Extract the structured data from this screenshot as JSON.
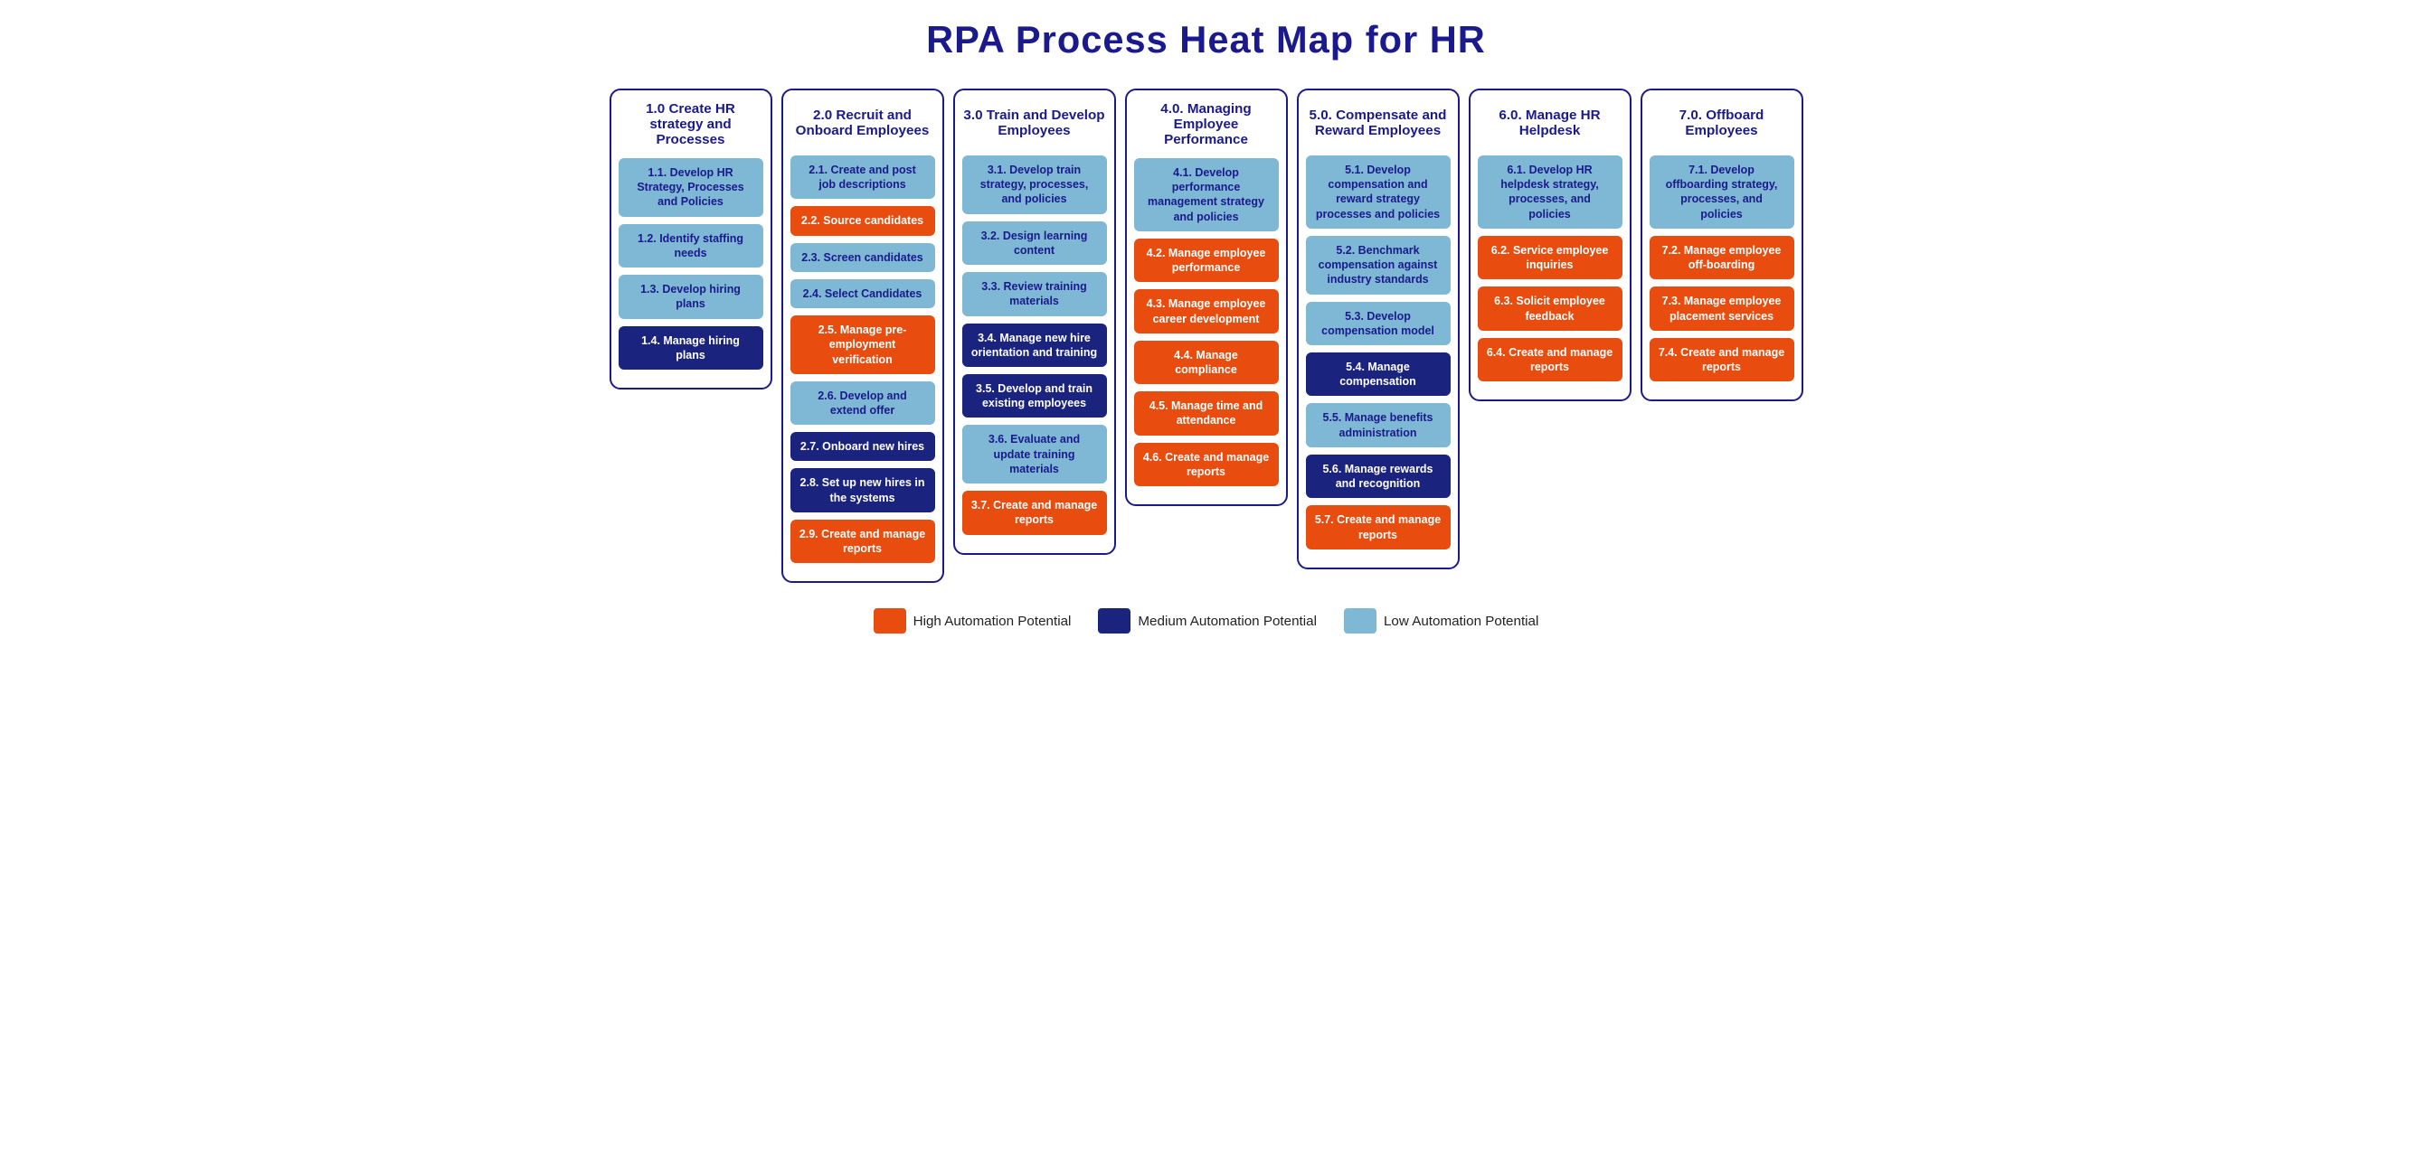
{
  "title": "RPA Process Heat Map for HR",
  "columns": [
    {
      "id": "col1",
      "header": "1.0 Create HR strategy and Processes",
      "cards": [
        {
          "label": "1.1. Develop HR Strategy, Processes and Policies",
          "level": "low"
        },
        {
          "label": "1.2. Identify staffing needs",
          "level": "low"
        },
        {
          "label": "1.3. Develop hiring plans",
          "level": "low"
        },
        {
          "label": "1.4. Manage hiring plans",
          "level": "medium"
        }
      ]
    },
    {
      "id": "col2",
      "header": "2.0 Recruit and Onboard Employees",
      "cards": [
        {
          "label": "2.1. Create and post job descriptions",
          "level": "low"
        },
        {
          "label": "2.2. Source candidates",
          "level": "high"
        },
        {
          "label": "2.3. Screen candidates",
          "level": "low"
        },
        {
          "label": "2.4. Select Candidates",
          "level": "low"
        },
        {
          "label": "2.5. Manage pre-employment verification",
          "level": "high"
        },
        {
          "label": "2.6. Develop and extend offer",
          "level": "low"
        },
        {
          "label": "2.7. Onboard new hires",
          "level": "medium"
        },
        {
          "label": "2.8. Set up new hires in the systems",
          "level": "medium"
        },
        {
          "label": "2.9. Create and manage reports",
          "level": "high"
        }
      ]
    },
    {
      "id": "col3",
      "header": "3.0 Train and Develop Employees",
      "cards": [
        {
          "label": "3.1. Develop train strategy, processes, and policies",
          "level": "low"
        },
        {
          "label": "3.2. Design learning content",
          "level": "low"
        },
        {
          "label": "3.3. Review training materials",
          "level": "low"
        },
        {
          "label": "3.4. Manage new hire orientation and training",
          "level": "medium"
        },
        {
          "label": "3.5. Develop and train existing employees",
          "level": "medium"
        },
        {
          "label": "3.6. Evaluate and update training materials",
          "level": "low"
        },
        {
          "label": "3.7. Create and manage reports",
          "level": "high"
        }
      ]
    },
    {
      "id": "col4",
      "header": "4.0. Managing Employee Performance",
      "cards": [
        {
          "label": "4.1. Develop performance management strategy and policies",
          "level": "low"
        },
        {
          "label": "4.2. Manage employee performance",
          "level": "high"
        },
        {
          "label": "4.3. Manage employee career development",
          "level": "high"
        },
        {
          "label": "4.4. Manage compliance",
          "level": "high"
        },
        {
          "label": "4.5. Manage time and attendance",
          "level": "high"
        },
        {
          "label": "4.6. Create and manage reports",
          "level": "high"
        }
      ]
    },
    {
      "id": "col5",
      "header": "5.0. Compensate and Reward Employees",
      "cards": [
        {
          "label": "5.1. Develop compensation and reward strategy processes and policies",
          "level": "low"
        },
        {
          "label": "5.2. Benchmark compensation against industry standards",
          "level": "low"
        },
        {
          "label": "5.3. Develop compensation model",
          "level": "low"
        },
        {
          "label": "5.4. Manage compensation",
          "level": "medium"
        },
        {
          "label": "5.5. Manage benefits administration",
          "level": "low"
        },
        {
          "label": "5.6. Manage rewards and recognition",
          "level": "medium"
        },
        {
          "label": "5.7. Create and manage reports",
          "level": "high"
        }
      ]
    },
    {
      "id": "col6",
      "header": "6.0. Manage HR Helpdesk",
      "cards": [
        {
          "label": "6.1. Develop HR helpdesk strategy, processes, and policies",
          "level": "low"
        },
        {
          "label": "6.2. Service employee inquiries",
          "level": "high"
        },
        {
          "label": "6.3. Solicit employee feedback",
          "level": "high"
        },
        {
          "label": "6.4. Create and manage reports",
          "level": "high"
        }
      ]
    },
    {
      "id": "col7",
      "header": "7.0. Offboard Employees",
      "cards": [
        {
          "label": "7.1. Develop offboarding strategy, processes, and policies",
          "level": "low"
        },
        {
          "label": "7.2. Manage employee off-boarding",
          "level": "high"
        },
        {
          "label": "7.3. Manage employee placement services",
          "level": "high"
        },
        {
          "label": "7.4. Create and manage reports",
          "level": "high"
        }
      ]
    }
  ],
  "legend": {
    "items": [
      {
        "label": "High Automation Potential",
        "level": "high"
      },
      {
        "label": "Medium Automation Potential",
        "level": "medium"
      },
      {
        "label": "Low Automation Potential",
        "level": "low"
      }
    ]
  }
}
